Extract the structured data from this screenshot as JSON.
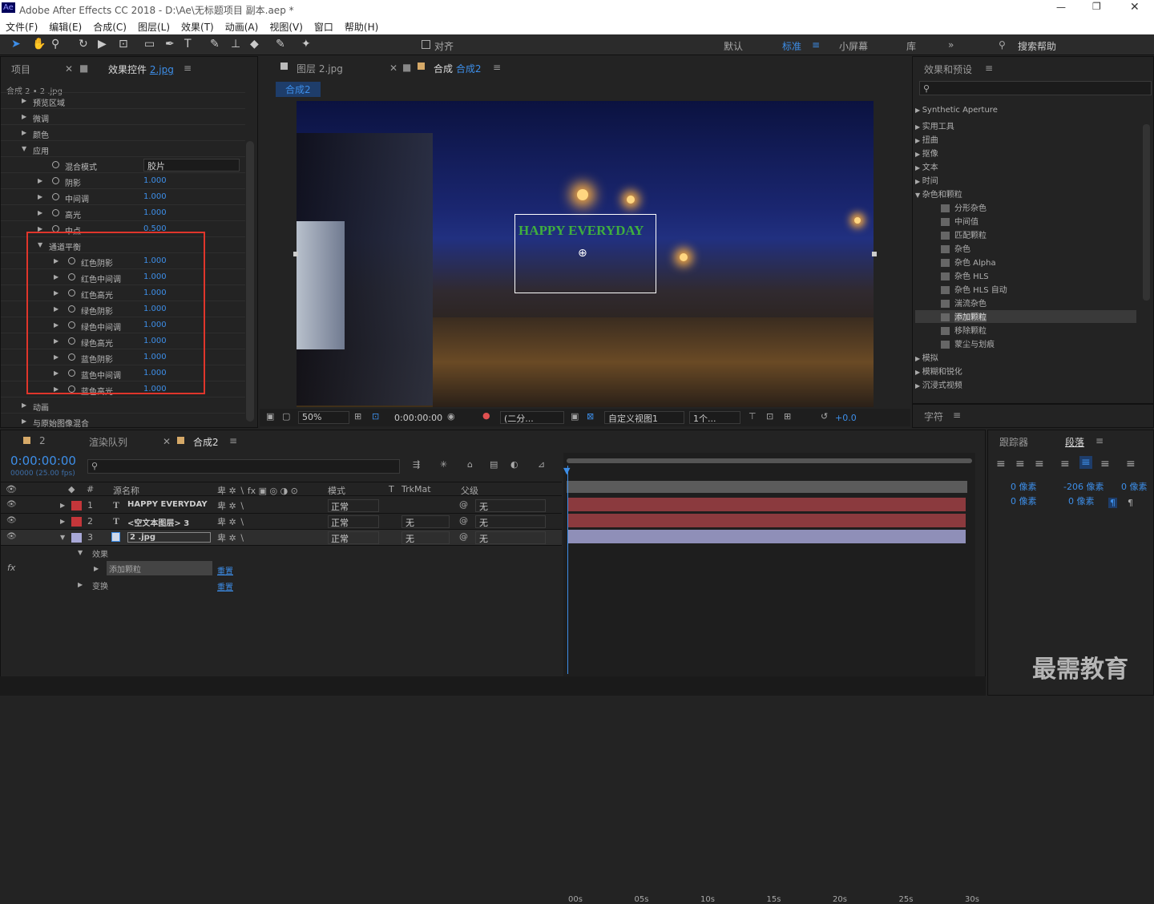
{
  "window": {
    "title": "Adobe After Effects CC 2018 - D:\\Ae\\无标题项目 副本.aep *",
    "ae_logo": "Ae"
  },
  "menu": [
    "文件(F)",
    "编辑(E)",
    "合成(C)",
    "图层(L)",
    "效果(T)",
    "动画(A)",
    "视图(V)",
    "窗口",
    "帮助(H)"
  ],
  "toolbar": {
    "align_label": "对齐",
    "workspaces": [
      "默认",
      "标准",
      "小屏幕",
      "库"
    ],
    "search_placeholder": "搜索帮助"
  },
  "left_panel": {
    "tab_project": "项目",
    "tab_effects": "效果控件",
    "tab_effects_file": "2.jpg",
    "breadcrumb": "合成 2 • 2 .jpg",
    "params": [
      {
        "label": "预览区域",
        "indent": 1
      },
      {
        "label": "微调",
        "indent": 1
      },
      {
        "label": "颜色",
        "indent": 1
      },
      {
        "label": "应用",
        "indent": 1,
        "open": true
      },
      {
        "label": "混合模式",
        "indent": 2,
        "dropdown": "胶片"
      },
      {
        "label": "阴影",
        "indent": 2,
        "value": "1.000"
      },
      {
        "label": "中间调",
        "indent": 2,
        "value": "1.000"
      },
      {
        "label": "高光",
        "indent": 2,
        "value": "1.000"
      },
      {
        "label": "中点",
        "indent": 2,
        "value": "0.500"
      },
      {
        "label": "通道平衡",
        "indent": 2,
        "open": true
      },
      {
        "label": "红色阴影",
        "indent": 3,
        "value": "1.000"
      },
      {
        "label": "红色中间调",
        "indent": 3,
        "value": "1.000"
      },
      {
        "label": "红色高光",
        "indent": 3,
        "value": "1.000"
      },
      {
        "label": "绿色阴影",
        "indent": 3,
        "value": "1.000"
      },
      {
        "label": "绿色中间调",
        "indent": 3,
        "value": "1.000"
      },
      {
        "label": "绿色高光",
        "indent": 3,
        "value": "1.000"
      },
      {
        "label": "蓝色阴影",
        "indent": 3,
        "value": "1.000"
      },
      {
        "label": "蓝色中间调",
        "indent": 3,
        "value": "1.000"
      },
      {
        "label": "蓝色高光",
        "indent": 3,
        "value": "1.000"
      },
      {
        "label": "动画",
        "indent": 1
      },
      {
        "label": "与原始图像混合",
        "indent": 1
      }
    ]
  },
  "viewer": {
    "tab_layer": "图层",
    "tab_layer_file": "2.jpg",
    "tab_comp": "合成",
    "tab_comp_name": "合成2",
    "comp_badge": "合成2",
    "overlay_text": "HAPPY EVERYDAY",
    "zoom": "50%",
    "timecode": "0:00:00:00",
    "resolution": "(二分...",
    "view": "自定义视图1",
    "views_count": "1个...",
    "exposure": "+0.0"
  },
  "effects_panel": {
    "title": "效果和预设",
    "items": [
      {
        "label": "Synthetic Aperture",
        "level": 0
      },
      {
        "label": "实用工具",
        "level": 0
      },
      {
        "label": "扭曲",
        "level": 0
      },
      {
        "label": "抠像",
        "level": 0
      },
      {
        "label": "文本",
        "level": 0
      },
      {
        "label": "时间",
        "level": 0
      },
      {
        "label": "杂色和颗粒",
        "level": 0,
        "open": true
      },
      {
        "label": "分形杂色",
        "level": 1
      },
      {
        "label": "中间值",
        "level": 1
      },
      {
        "label": "匹配颗粒",
        "level": 1
      },
      {
        "label": "杂色",
        "level": 1
      },
      {
        "label": "杂色 Alpha",
        "level": 1
      },
      {
        "label": "杂色 HLS",
        "level": 1
      },
      {
        "label": "杂色 HLS 自动",
        "level": 1
      },
      {
        "label": "湍流杂色",
        "level": 1
      },
      {
        "label": "添加颗粒",
        "level": 1,
        "selected": true
      },
      {
        "label": "移除颗粒",
        "level": 1
      },
      {
        "label": "蒙尘与划痕",
        "level": 1
      },
      {
        "label": "模拟",
        "level": 0
      },
      {
        "label": "模糊和锐化",
        "level": 0
      },
      {
        "label": "沉浸式视频",
        "level": 0
      }
    ]
  },
  "char_panel": {
    "title": "字符"
  },
  "timeline": {
    "tab_2": "2",
    "tab_render": "渲染队列",
    "tab_comp": "合成2",
    "timecode": "0:00:00:00",
    "fps": "00000 (25.00 fps)",
    "headers": {
      "num": "#",
      "name": "源名称",
      "mode": "模式",
      "t": "T",
      "trkmat": "TrkMat",
      "parent": "父级"
    },
    "layers": [
      {
        "num": "1",
        "type": "T",
        "name": "HAPPY EVERYDAY",
        "mode": "正常",
        "trk": "",
        "parent": "无",
        "color": "#c4363a"
      },
      {
        "num": "2",
        "type": "T",
        "name": "<空文本图层> 3",
        "mode": "正常",
        "trk": "无",
        "parent": "无",
        "color": "#c4363a"
      },
      {
        "num": "3",
        "type": "img",
        "name": "2 .jpg",
        "mode": "正常",
        "trk": "无",
        "parent": "无",
        "color": "#a9a9d8"
      }
    ],
    "sub": {
      "effects": "效果",
      "effect_name": "添加颗粒",
      "reset": "重置",
      "transform": "变换",
      "reset2": "重置"
    },
    "ruler": [
      "00s",
      "05s",
      "10s",
      "15s",
      "20s",
      "25s",
      "30s"
    ]
  },
  "tracker": {
    "tab": "跟踪器",
    "tab2": "段落",
    "indent_vals": [
      "0 像素",
      "-206 像素",
      "0 像素",
      "0 像素",
      "0 像素"
    ]
  },
  "watermark": "最需教育",
  "colors": {
    "accent": "#3d8ee8",
    "highlight_box": "#e0352b",
    "text_overlay": "#3fae3f"
  }
}
